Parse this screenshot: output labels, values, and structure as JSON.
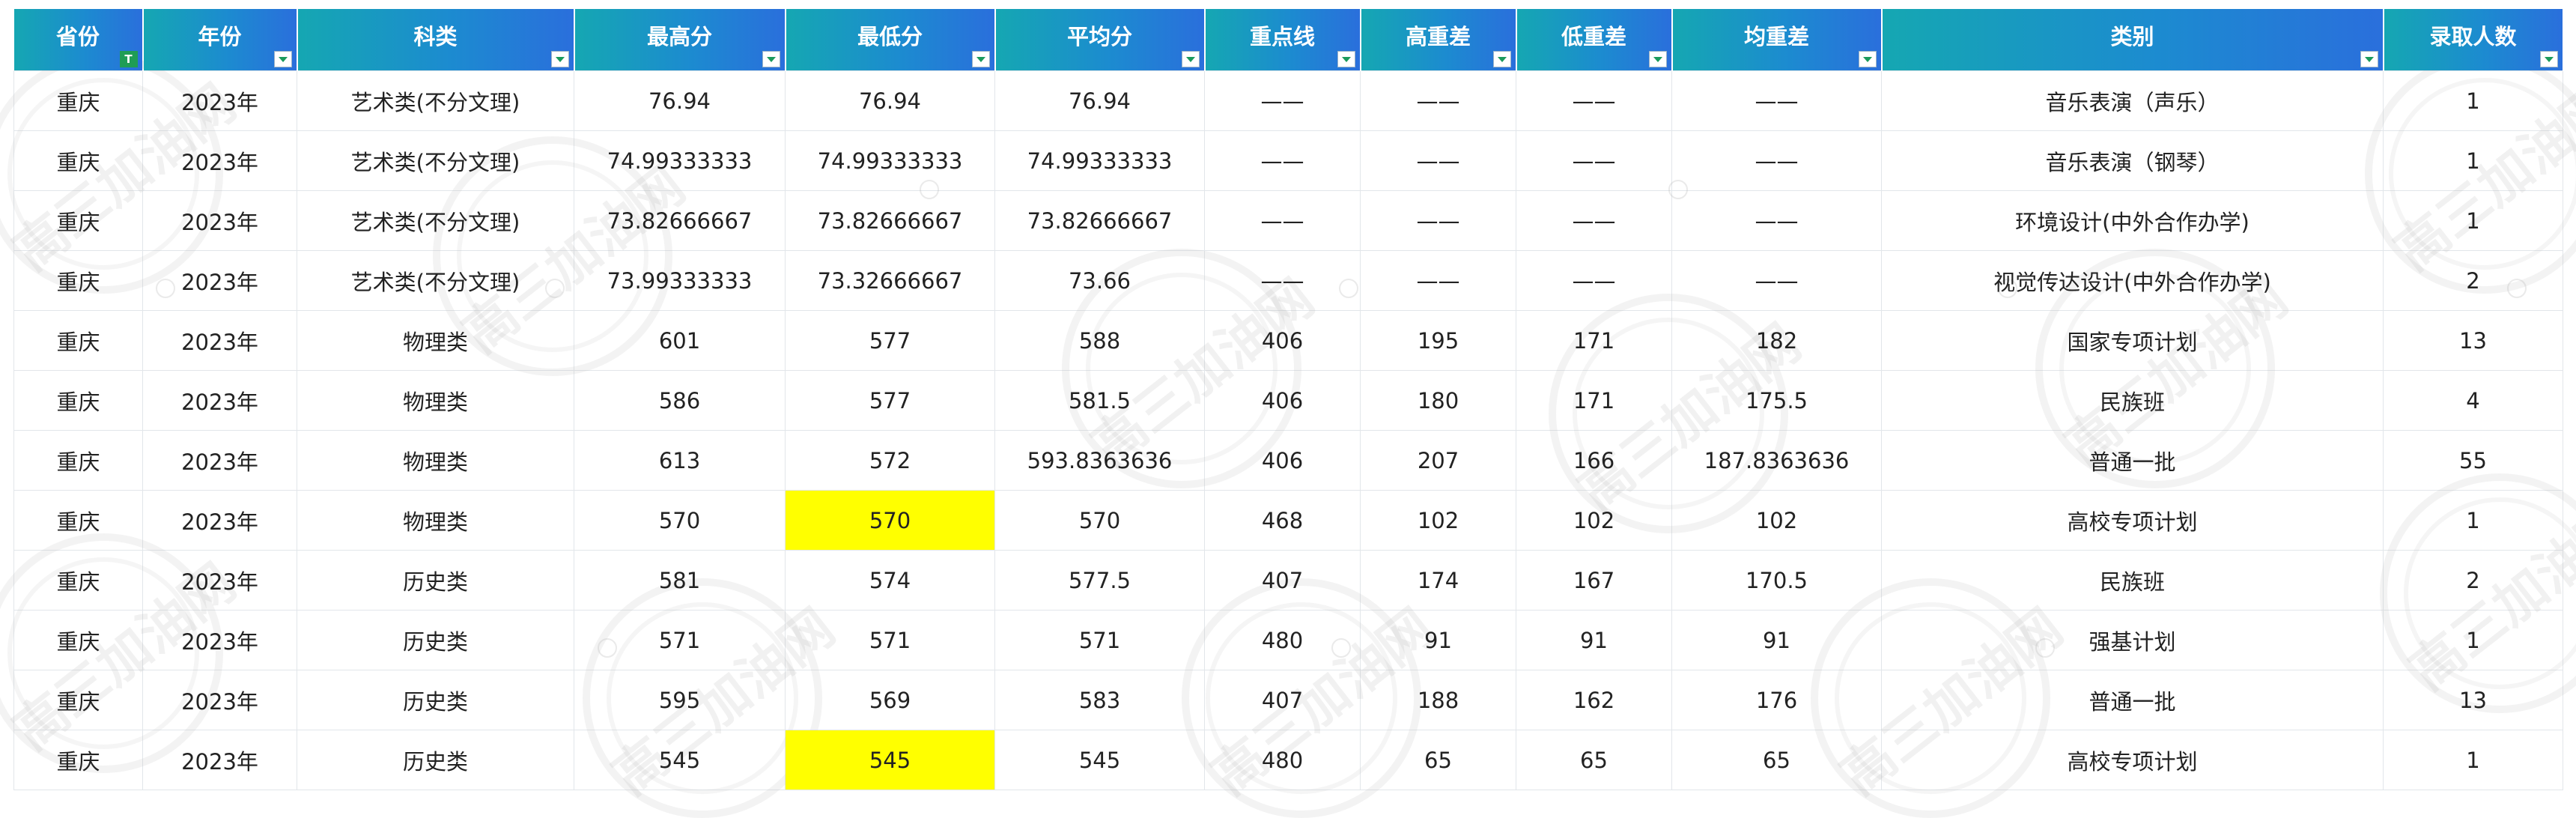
{
  "table": {
    "headers": [
      "省份",
      "年份",
      "科类",
      "最高分",
      "最低分",
      "平均分",
      "重点线",
      "高重差",
      "低重差",
      "均重差",
      "类别",
      "录取人数"
    ],
    "filter_active_label": "T",
    "rows": [
      [
        "重庆",
        "2023年",
        "艺术类(不分文理)",
        "76.94",
        "76.94",
        "76.94",
        "——",
        "——",
        "——",
        "——",
        "音乐表演（声乐）",
        "1"
      ],
      [
        "重庆",
        "2023年",
        "艺术类(不分文理)",
        "74.99333333",
        "74.99333333",
        "74.99333333",
        "——",
        "——",
        "——",
        "——",
        "音乐表演（钢琴）",
        "1"
      ],
      [
        "重庆",
        "2023年",
        "艺术类(不分文理)",
        "73.82666667",
        "73.82666667",
        "73.82666667",
        "——",
        "——",
        "——",
        "——",
        "环境设计(中外合作办学)",
        "1"
      ],
      [
        "重庆",
        "2023年",
        "艺术类(不分文理)",
        "73.99333333",
        "73.32666667",
        "73.66",
        "——",
        "——",
        "——",
        "——",
        "视觉传达设计(中外合作办学)",
        "2"
      ],
      [
        "重庆",
        "2023年",
        "物理类",
        "601",
        "577",
        "588",
        "406",
        "195",
        "171",
        "182",
        "国家专项计划",
        "13"
      ],
      [
        "重庆",
        "2023年",
        "物理类",
        "586",
        "577",
        "581.5",
        "406",
        "180",
        "171",
        "175.5",
        "民族班",
        "4"
      ],
      [
        "重庆",
        "2023年",
        "物理类",
        "613",
        "572",
        "593.8363636",
        "406",
        "207",
        "166",
        "187.8363636",
        "普通一批",
        "55"
      ],
      [
        "重庆",
        "2023年",
        "物理类",
        "570",
        "570",
        "570",
        "468",
        "102",
        "102",
        "102",
        "高校专项计划",
        "1"
      ],
      [
        "重庆",
        "2023年",
        "历史类",
        "581",
        "574",
        "577.5",
        "407",
        "174",
        "167",
        "170.5",
        "民族班",
        "2"
      ],
      [
        "重庆",
        "2023年",
        "历史类",
        "571",
        "571",
        "571",
        "480",
        "91",
        "91",
        "91",
        "强基计划",
        "1"
      ],
      [
        "重庆",
        "2023年",
        "历史类",
        "595",
        "569",
        "583",
        "407",
        "188",
        "162",
        "176",
        "普通一批",
        "13"
      ],
      [
        "重庆",
        "2023年",
        "历史类",
        "545",
        "545",
        "545",
        "480",
        "65",
        "65",
        "65",
        "高校专项计划",
        "1"
      ]
    ],
    "highlighted_cells": [
      [
        7,
        4
      ],
      [
        11,
        4
      ]
    ],
    "highlight_color": "#ffff00"
  },
  "watermark": {
    "text": "高三加油网"
  }
}
